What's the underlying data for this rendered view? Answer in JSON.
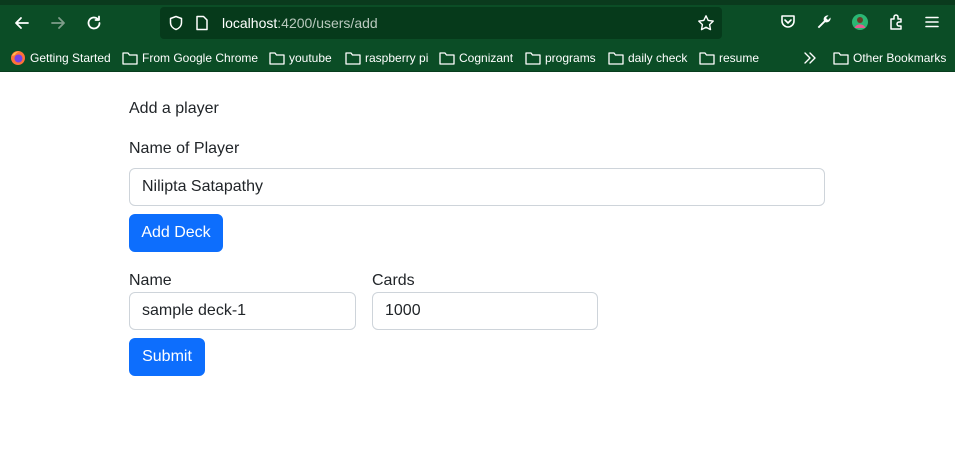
{
  "browser": {
    "url_host": "localhost",
    "url_path": ":4200/users/add",
    "bookmarks": [
      "Getting Started",
      "From Google Chrome",
      "youtube",
      "raspberry pi",
      "Cognizant",
      "programs",
      "daily check",
      "resume"
    ],
    "other_bookmarks": "Other Bookmarks"
  },
  "form": {
    "heading": "Add a player",
    "player_name_label": "Name of Player",
    "player_name_value": "Nilipta Satapathy",
    "add_deck_label": "Add Deck",
    "deck_name_label": "Name",
    "deck_name_value": "sample deck-1",
    "cards_label": "Cards",
    "cards_value": "1000",
    "submit_label": "Submit"
  },
  "colors": {
    "browser_bg": "#0b4d26",
    "primary": "#0d6efd"
  }
}
